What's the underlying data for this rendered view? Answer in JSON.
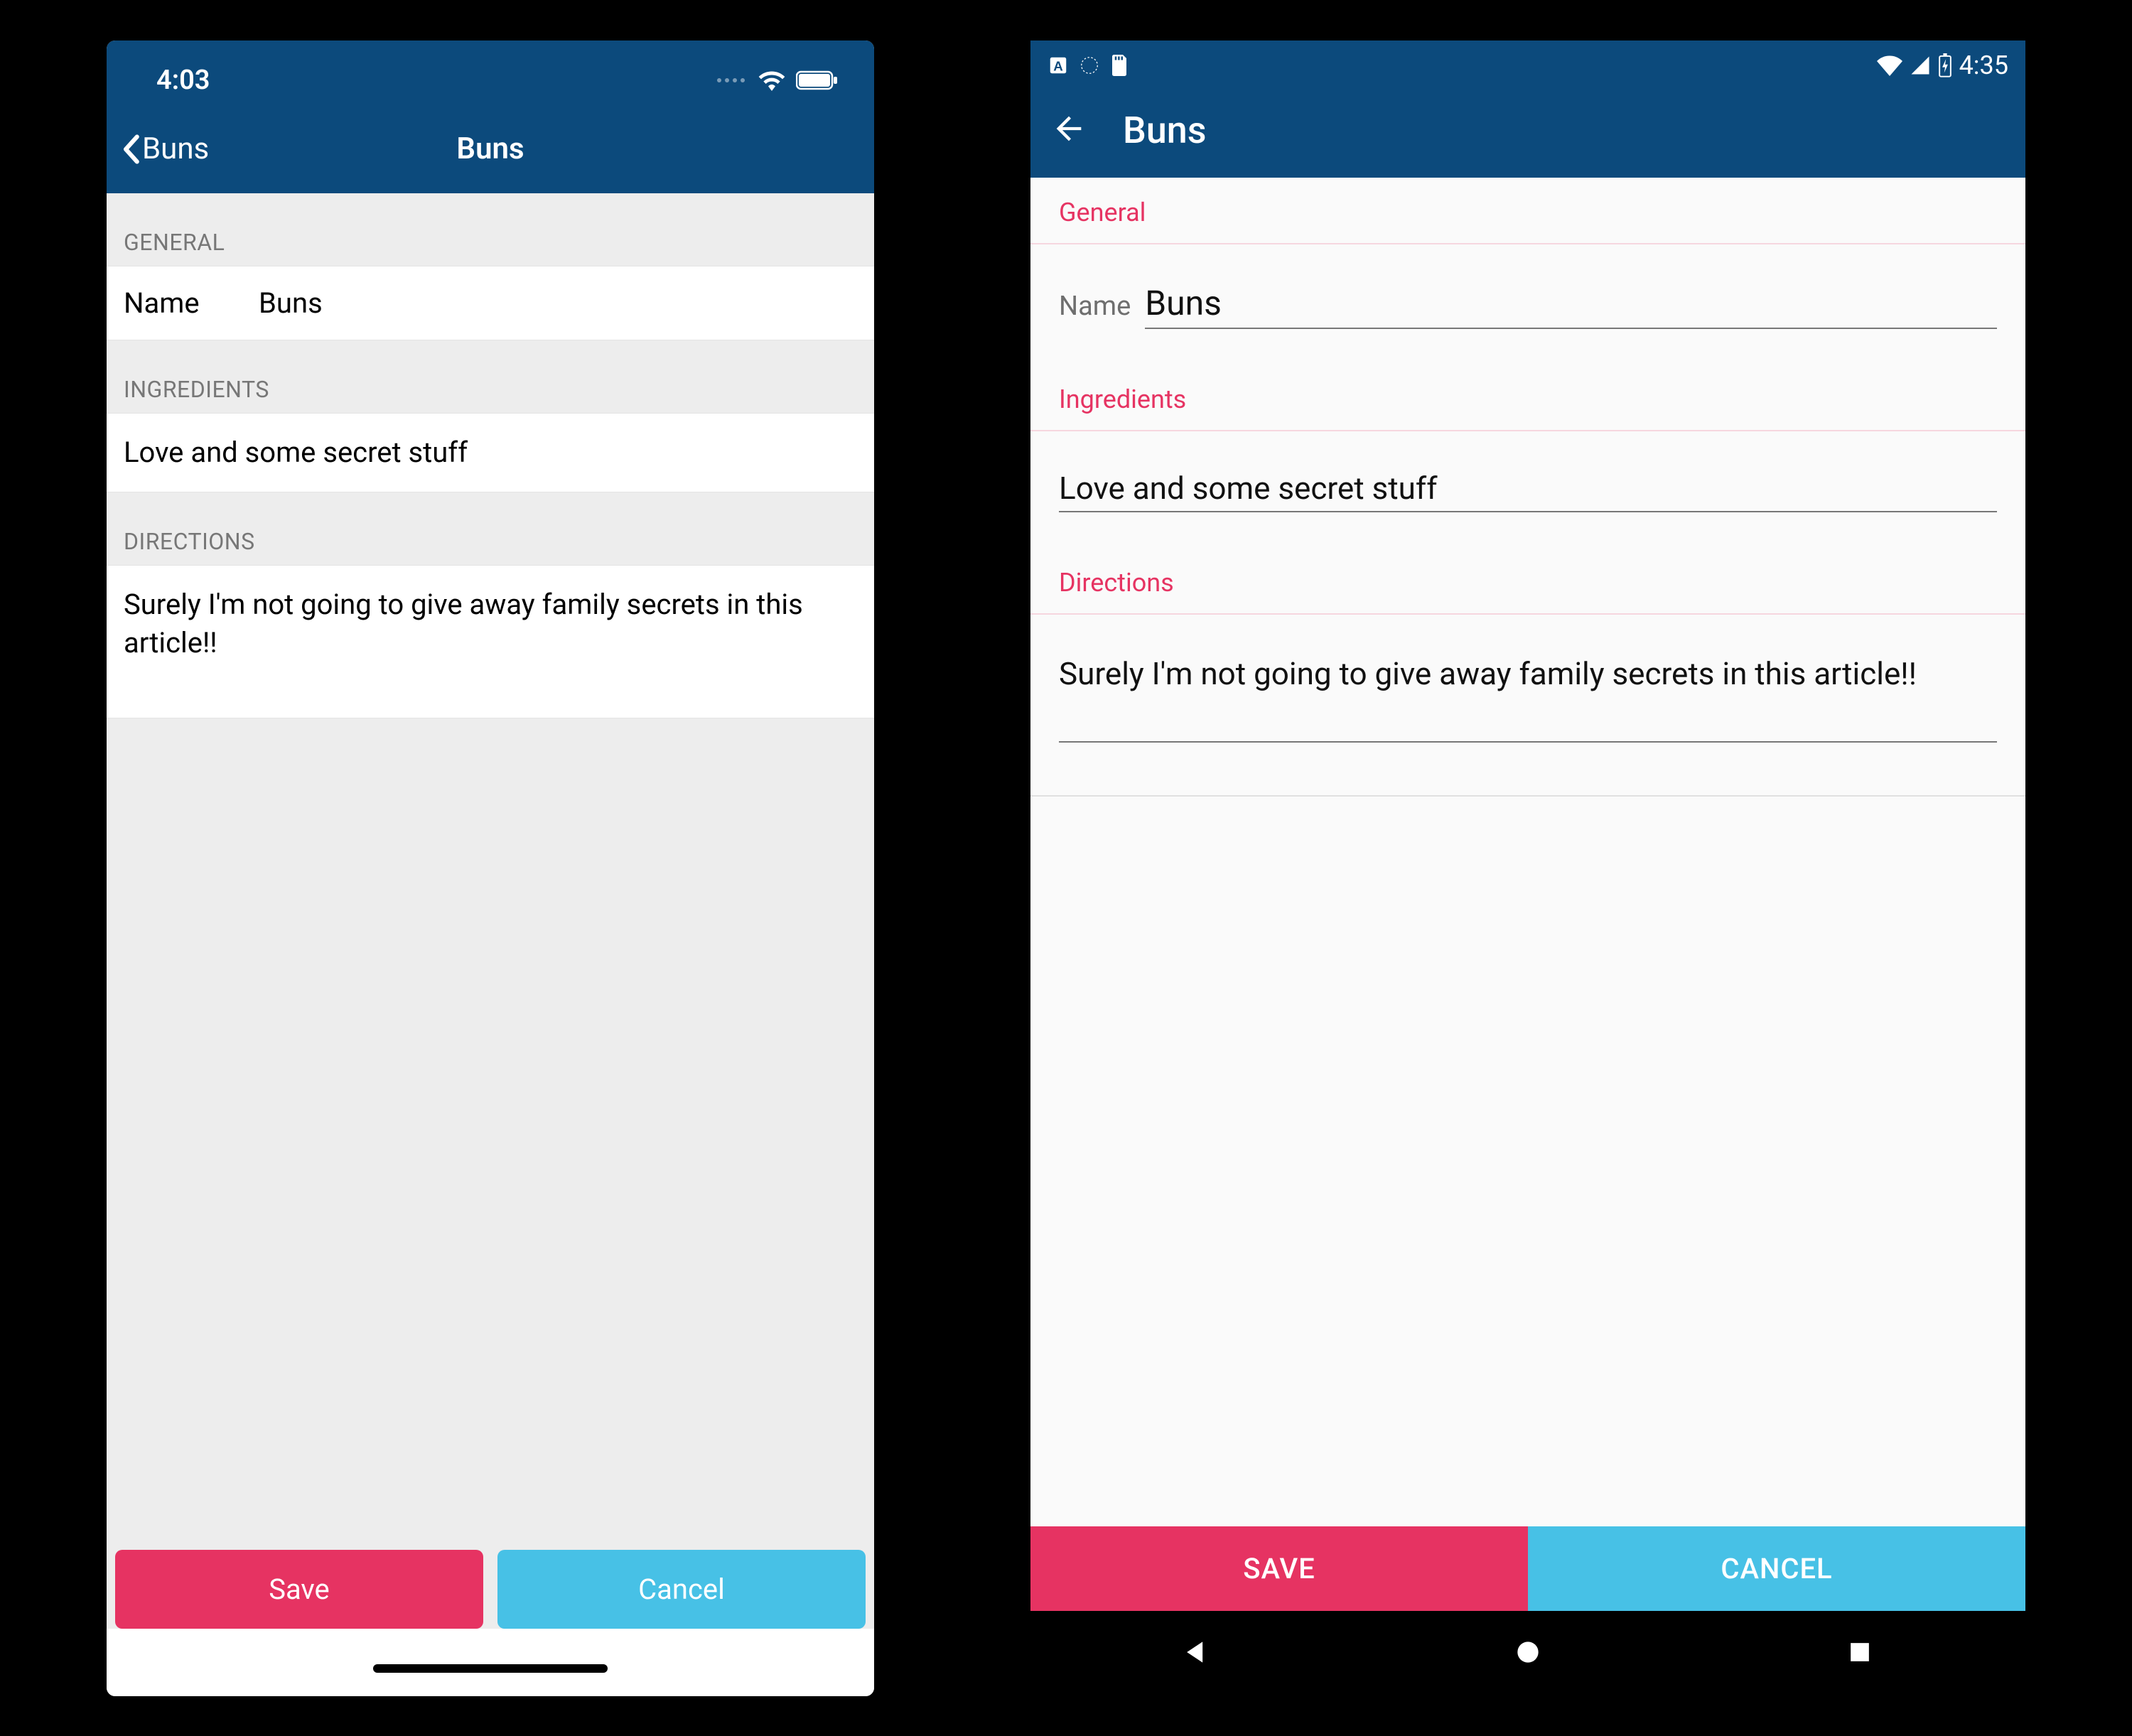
{
  "ios": {
    "statusbar": {
      "time": "4:03"
    },
    "nav": {
      "back_label": "Buns",
      "title": "Buns"
    },
    "sections": {
      "general": {
        "header": "GENERAL",
        "name_label": "Name",
        "name_value": "Buns"
      },
      "ingredients": {
        "header": "INGREDIENTS",
        "text": "Love and some secret stuff"
      },
      "directions": {
        "header": "DIRECTIONS",
        "text": "Surely I'm not going to give away family secrets in this article!!"
      }
    },
    "buttons": {
      "save": "Save",
      "cancel": "Cancel"
    }
  },
  "android": {
    "statusbar": {
      "time": "4:35"
    },
    "appbar": {
      "title": "Buns"
    },
    "sections": {
      "general": {
        "header": "General",
        "name_label": "Name",
        "name_value": "Buns"
      },
      "ingredients": {
        "header": "Ingredients",
        "text": "Love and some secret stuff"
      },
      "directions": {
        "header": "Directions",
        "text": "Surely I'm not going to give away family secrets in this article!!"
      }
    },
    "buttons": {
      "save": "SAVE",
      "cancel": "CANCEL"
    }
  }
}
